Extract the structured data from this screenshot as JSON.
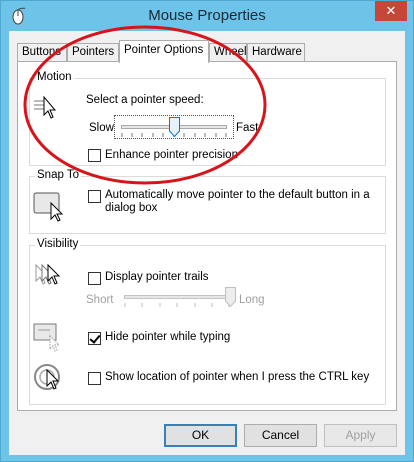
{
  "window": {
    "title": "Mouse Properties",
    "close_label": "✕"
  },
  "tabs": [
    {
      "label": "Buttons"
    },
    {
      "label": "Pointers"
    },
    {
      "label": "Pointer Options"
    },
    {
      "label": "Wheel"
    },
    {
      "label": "Hardware"
    }
  ],
  "motion": {
    "group_label": "Motion",
    "speed_label": "Select a pointer speed:",
    "slow_label": "Slow",
    "fast_label": "Fast",
    "speed_value": 0.5,
    "enhance_label": "Enhance pointer precision",
    "enhance_checked": false
  },
  "snap": {
    "group_label": "Snap To",
    "auto_move_line1": "Automatically move pointer to the default button in a",
    "auto_move_line2": "dialog box",
    "auto_move_checked": false
  },
  "visibility": {
    "group_label": "Visibility",
    "trails_label": "Display pointer trails",
    "trails_checked": false,
    "short_label": "Short",
    "long_label": "Long",
    "trails_value": 1.0,
    "hide_label": "Hide pointer while typing",
    "hide_checked": true,
    "show_location_label": "Show location of pointer when I press the CTRL key",
    "show_location_checked": false
  },
  "buttons": {
    "ok": "OK",
    "cancel": "Cancel",
    "apply": "Apply"
  },
  "colors": {
    "titlebar": "#6ec3e8",
    "close": "#c7463a",
    "annotation": "#d8141b"
  }
}
